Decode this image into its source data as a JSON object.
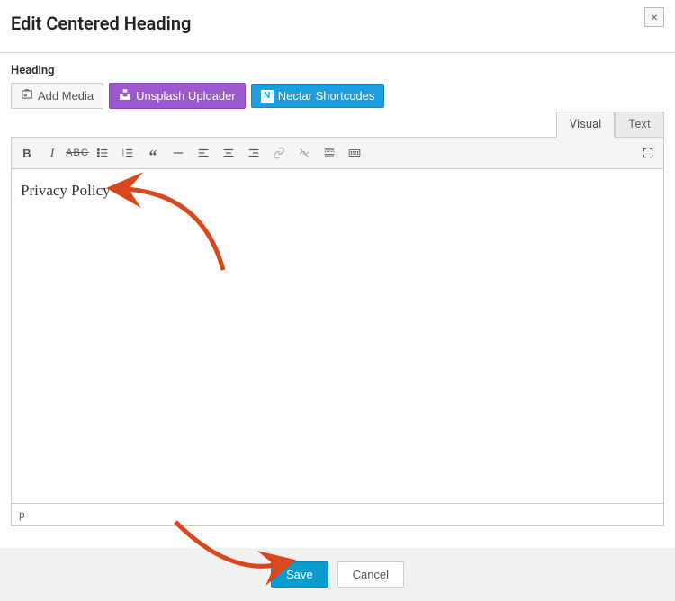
{
  "header": {
    "title": "Edit Centered Heading",
    "close": "×"
  },
  "section": {
    "label": "Heading"
  },
  "buttons": {
    "add_media": "Add Media",
    "unsplash": "Unsplash Uploader",
    "nectar": "Nectar Shortcodes"
  },
  "tabs": {
    "visual": "Visual",
    "text": "Text"
  },
  "toolbar_icons": [
    "bold-icon",
    "italic-icon",
    "strikethrough-icon",
    "bullet-list-icon",
    "numbered-list-icon",
    "blockquote-icon",
    "hr-icon",
    "align-left-icon",
    "align-center-icon",
    "align-right-icon",
    "link-icon",
    "unlink-icon",
    "more-icon",
    "keyboard-icon",
    "fullscreen-icon"
  ],
  "editor": {
    "content": "Privacy Policy",
    "status_path": "p"
  },
  "footer": {
    "save": "Save",
    "cancel": "Cancel"
  }
}
